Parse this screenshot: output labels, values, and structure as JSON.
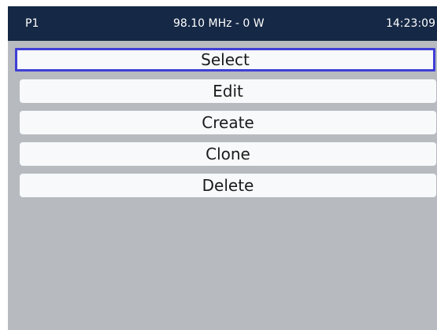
{
  "status_bar": {
    "preset": "P1",
    "frequency_power": "98.10 MHz - 0 W",
    "time": "14:23:09"
  },
  "menu": {
    "items": [
      {
        "label": "Select",
        "selected": true
      },
      {
        "label": "Edit",
        "selected": false
      },
      {
        "label": "Create",
        "selected": false
      },
      {
        "label": "Clone",
        "selected": false
      },
      {
        "label": "Delete",
        "selected": false
      }
    ]
  },
  "colors": {
    "status_bar_bg": "#152845",
    "content_bg": "#b7bbc0",
    "item_bg": "#f7f9fa",
    "selection_border": "#3f3fd6"
  }
}
